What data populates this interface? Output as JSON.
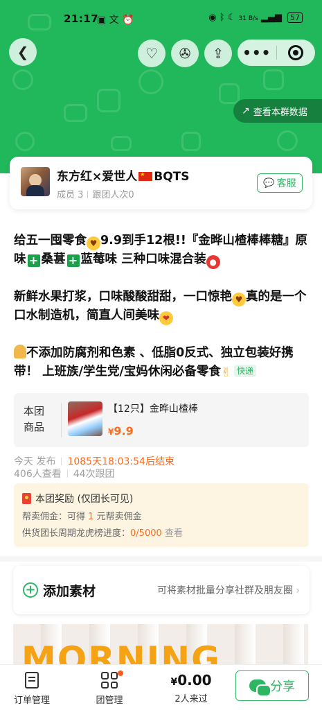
{
  "status_bar": {
    "time": "21:17",
    "network_speed": "31 B/s",
    "battery": "57"
  },
  "header": {
    "group_data_label": "查看本群数据"
  },
  "group": {
    "name_part1": "东方红×爱世人",
    "name_part2": "BQTS",
    "members": "成员 3",
    "followers": "跟团人次0",
    "service_button": "客服"
  },
  "description": {
    "p1_a": "给五一囤零食",
    "p1_b": "9.9到手12根!!『金晔山楂棒棒糖』原味",
    "p1_c": "桑葚",
    "p1_d": "蓝莓味 三种口味混合装",
    "p2_a": "新鲜水果打浆，口味酸酸甜甜，一口惊艳",
    "p2_b": "真的是一个口水制造机，简直人间美味",
    "p3_a": "不添加防腐剂和色素 、低脂0反式、独立包装好携带！ 上班族/学生党/宝妈休闲必备零食",
    "express_tag": "快递"
  },
  "product": {
    "section_label": "本团商品",
    "name": "【12只】金晔山楂棒",
    "currency": "¥",
    "price": "9.9"
  },
  "post_meta": {
    "published": "今天 发布",
    "ends_in": "1085天18:03:54后结束",
    "views": "406人查看",
    "joins": "44次跟团"
  },
  "reward": {
    "title": "本团奖励 (仅团长可见)",
    "commission_label": "帮卖佣金：可得",
    "commission_value": "1",
    "commission_unit": "元帮卖佣金",
    "leaderboard_label": "供货团长周期龙虎榜进度：",
    "leaderboard_value": "0/5000",
    "leaderboard_link": "查看"
  },
  "material": {
    "title": "添加素材",
    "hint": "可将素材批量分享社群及朋友圈"
  },
  "photo": {
    "text": "MORNING"
  },
  "tabbar": {
    "orders": "订单管理",
    "group_manage": "团管理",
    "currency": "¥",
    "amount": "0.00",
    "visitors": "2人来过",
    "share": "分享"
  },
  "colors": {
    "brand_green": "#20b85a",
    "accent_orange": "#ff6a1a"
  }
}
